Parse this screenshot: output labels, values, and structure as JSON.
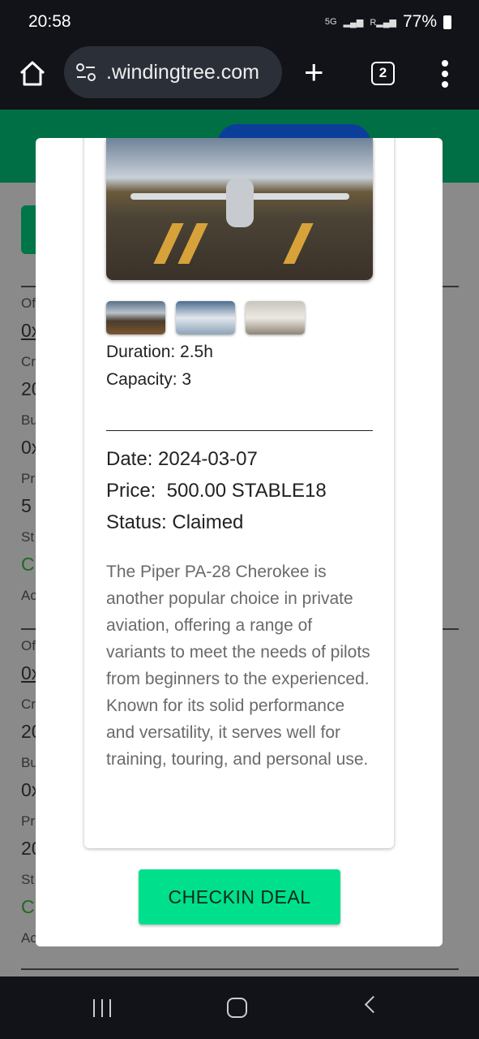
{
  "status_bar": {
    "time": "20:58",
    "network": "5G",
    "battery": "77%"
  },
  "browser": {
    "url": ".windingtree.com",
    "tab_count": "2"
  },
  "background_list": [
    {
      "label1": "Of",
      "value1": "0x",
      "label2": "Cr",
      "value2": "20",
      "label3": "Bu",
      "value3": "0x",
      "label4": "Pr",
      "value4": "5",
      "label5": "St",
      "value5": "C",
      "label6": "Ac"
    },
    {
      "label1": "Of",
      "value1": "0x",
      "label2": "Cr",
      "value2": "20",
      "label3": "Bu",
      "value3": "0x",
      "label4": "Pr",
      "value4": "20",
      "label5": "St",
      "value5": "C",
      "label6": "Ac"
    }
  ],
  "modal": {
    "duration": "Duration: 2.5h",
    "capacity": "Capacity: 3",
    "date": "Date: 2024-03-07",
    "price": "Price:  500.00 STABLE18",
    "status": "Status: Claimed",
    "description": "The Piper PA-28 Cherokee is another popular choice in private aviation, offering a range of variants to meet the needs of pilots from beginners to the experienced. Known for its solid performance and versatility, it serves well for training, touring, and personal use.",
    "checkin_label": "CHECKIN DEAL"
  },
  "colors": {
    "accent": "#00e08c",
    "header": "#006f45",
    "header_button": "#0b3e9a",
    "status_text": "#1f6a1f"
  }
}
